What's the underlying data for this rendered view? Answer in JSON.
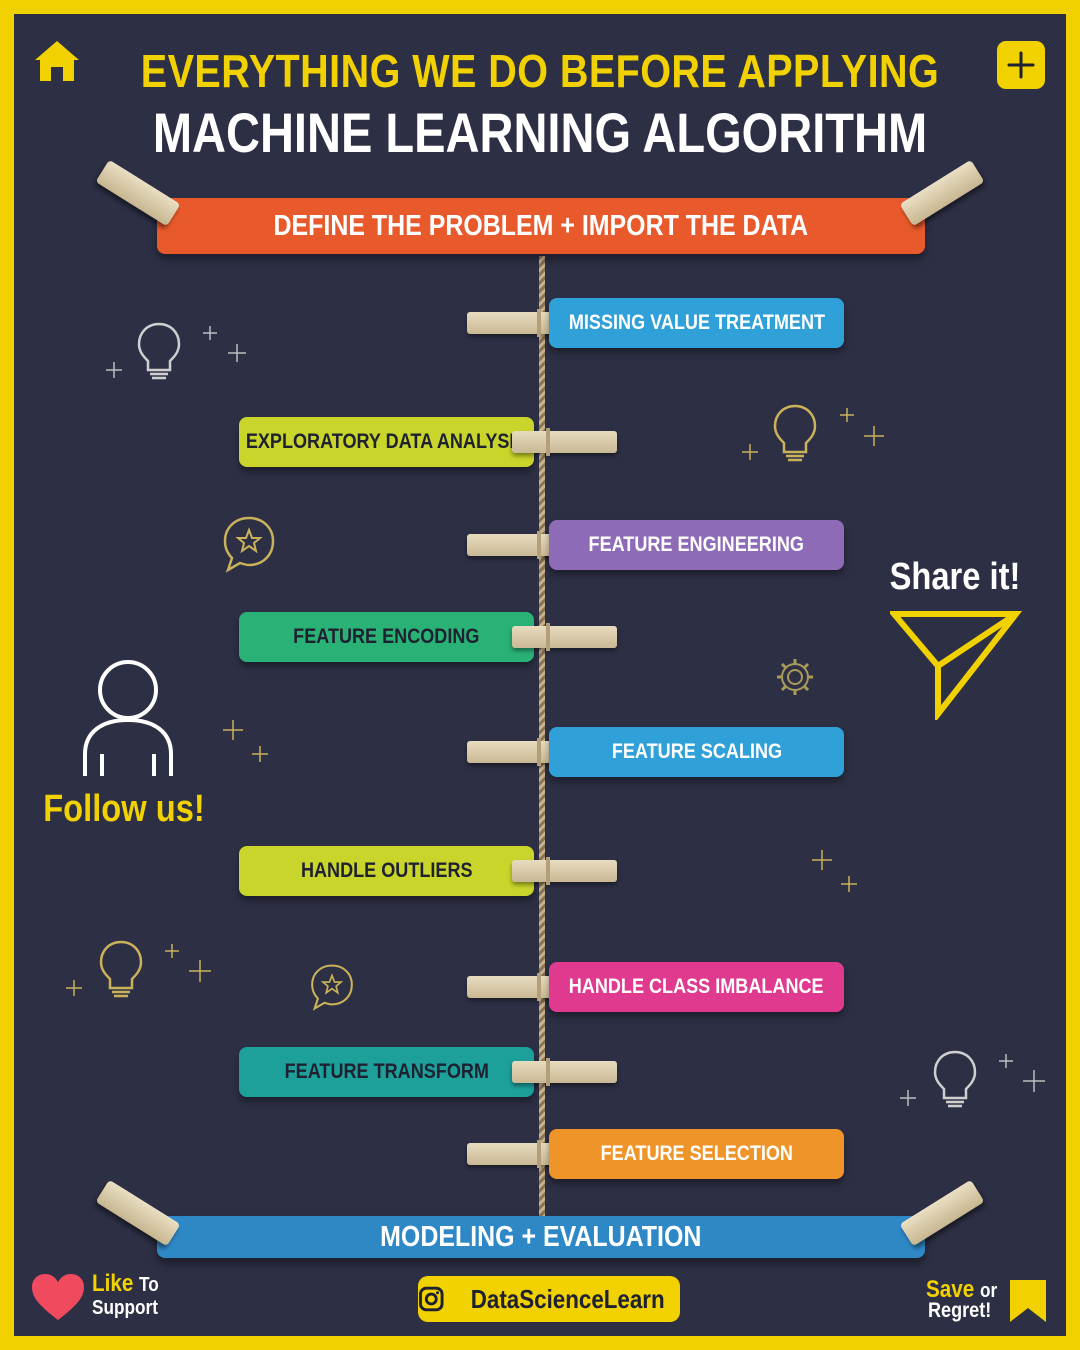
{
  "header": {
    "line1": "EVERYTHING WE DO BEFORE APPLYING",
    "line2": "MACHINE LEARNING ALGORITHM"
  },
  "top_banner": {
    "label": "DEFINE THE PROBLEM + IMPORT THE DATA",
    "color": "#e85a2c"
  },
  "bottom_banner": {
    "label": "MODELING + EVALUATION",
    "color": "#2f88c6"
  },
  "steps": [
    {
      "label": "MISSING VALUE TREATMENT",
      "side": "right",
      "color": "#2fa0d8"
    },
    {
      "label": "EXPLORATORY DATA ANALYSIS",
      "side": "left",
      "color": "#c9d52a"
    },
    {
      "label": "FEATURE ENGINEERING",
      "side": "right",
      "color": "#8e6bb7"
    },
    {
      "label": "FEATURE ENCODING",
      "side": "left",
      "color": "#2ab276"
    },
    {
      "label": "FEATURE SCALING",
      "side": "right",
      "color": "#2fa0d8"
    },
    {
      "label": "HANDLE OUTLIERS",
      "side": "left",
      "color": "#c9d52a"
    },
    {
      "label": "HANDLE CLASS IMBALANCE",
      "side": "right",
      "color": "#e03a8f"
    },
    {
      "label": "FEATURE TRANSFORM",
      "side": "left",
      "color": "#1da09a"
    },
    {
      "label": "FEATURE SELECTION",
      "side": "right",
      "color": "#ef9429"
    }
  ],
  "side": {
    "follow_label": "Follow us!",
    "share_label": "Share it!"
  },
  "footer": {
    "like_main": "Like",
    "like_to": "To",
    "like_sub": "Support",
    "handle": "DataScienceLearn",
    "save_main": "Save",
    "save_or": "or",
    "save_sub": "Regret!"
  },
  "icons": {
    "home": "home-icon",
    "plus": "plus-icon",
    "person": "person-icon",
    "share": "paper-plane-icon",
    "heart": "heart-icon",
    "instagram": "instagram-icon",
    "bookmark": "bookmark-icon",
    "bulb": "lightbulb-icon",
    "chat": "chat-star-icon",
    "gear": "gear-icon"
  },
  "colors": {
    "accent": "#f2d100",
    "background": "#2d2f45"
  }
}
